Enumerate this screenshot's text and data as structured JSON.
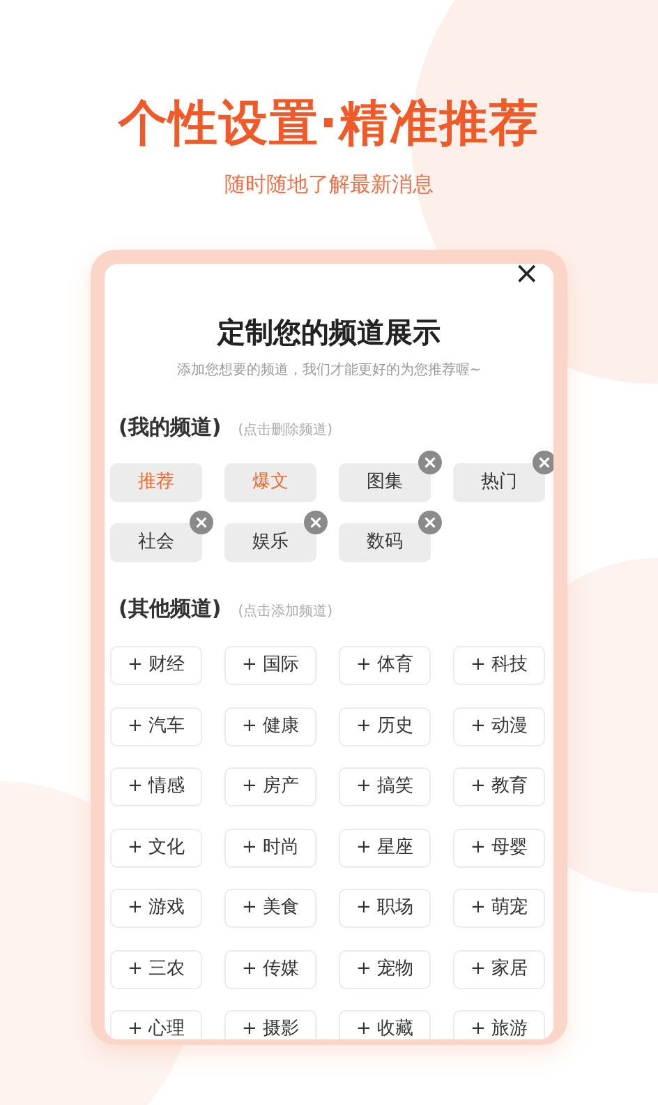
{
  "headline": "个性设置·精准推荐",
  "tagline": "随时随地了解最新消息",
  "dialog": {
    "close": "×",
    "title": "定制您的频道展示",
    "subtitle": "添加您想要的频道，我们才能更好的为您推荐喔~",
    "my_channels": {
      "heading": "(我的频道)",
      "hint": "(点击删除频道)",
      "items": [
        {
          "label": "推荐",
          "highlighted": true
        },
        {
          "label": "爆文",
          "highlighted": true
        },
        {
          "label": "图集",
          "highlighted": false
        },
        {
          "label": "热门",
          "highlighted": false
        },
        {
          "label": "社会",
          "highlighted": false
        },
        {
          "label": "娱乐",
          "highlighted": false
        },
        {
          "label": "数码",
          "highlighted": false
        }
      ]
    },
    "other_channels": {
      "heading": "(其他频道)",
      "hint": "(点击添加频道)",
      "items": [
        "+ 财经",
        "+ 国际",
        "+ 体育",
        "+ 科技",
        "+ 汽车",
        "+ 健康",
        "+ 历史",
        "+ 动漫",
        "+ 情感",
        "+ 房产",
        "+ 搞笑",
        "+ 教育",
        "+ 文化",
        "+ 时尚",
        "+ 星座",
        "+ 母婴",
        "+ 游戏",
        "+ 美食",
        "+ 职场",
        "+ 萌宠",
        "+ 三农",
        "+ 传媒",
        "+ 宠物",
        "+ 家居",
        "+ 心理",
        "+ 摄影",
        "+ 收藏",
        "+ 旅游"
      ]
    }
  }
}
